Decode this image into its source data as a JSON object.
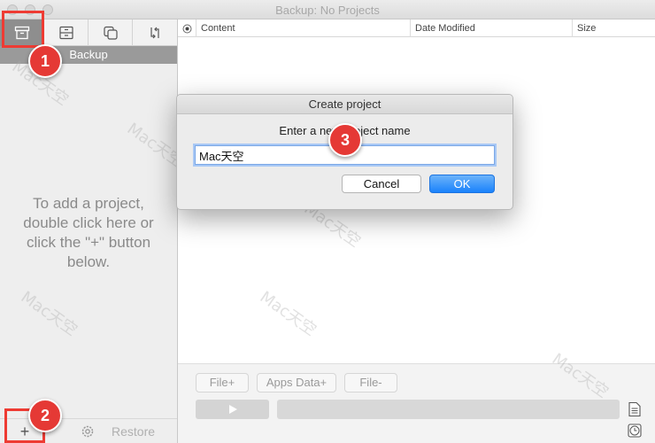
{
  "window": {
    "title": "Backup: No Projects"
  },
  "sidebar": {
    "tabs": [
      {
        "name": "backup-tab",
        "icon": "archive-box-icon",
        "active": true
      },
      {
        "name": "restore-tab",
        "icon": "drawer-icon",
        "active": false
      },
      {
        "name": "copy-tab",
        "icon": "duplicate-icon",
        "active": false
      },
      {
        "name": "sync-tab",
        "icon": "sync-arrows-icon",
        "active": false
      }
    ],
    "section_label": "Backup",
    "hint_lines": [
      "To add a project,",
      "double click here or",
      "click the \"+\" button",
      "below."
    ],
    "bottom": {
      "add_label": "+",
      "settings_icon": "gear-icon",
      "restore_label": "Restore"
    }
  },
  "list": {
    "columns": [
      "Content",
      "Date Modified",
      "Size"
    ]
  },
  "toolbar": {
    "buttons": [
      "File+",
      "Apps Data+",
      "File-"
    ],
    "play_icon": "play-icon",
    "side_icons": [
      "document-icon",
      "clock-icon"
    ]
  },
  "dialog": {
    "title": "Create project",
    "prompt": "Enter a new project name",
    "input_value": "Mac天空",
    "cancel_label": "Cancel",
    "ok_label": "OK"
  },
  "annotations": {
    "badges": [
      "1",
      "2",
      "3"
    ],
    "badge_color": "#e53935"
  },
  "watermark_text": "Mac天空",
  "colors": {
    "accent_blue": "#1a82fb",
    "active_tab": "#8e8e8e",
    "section_header": "#9a9a9a"
  }
}
